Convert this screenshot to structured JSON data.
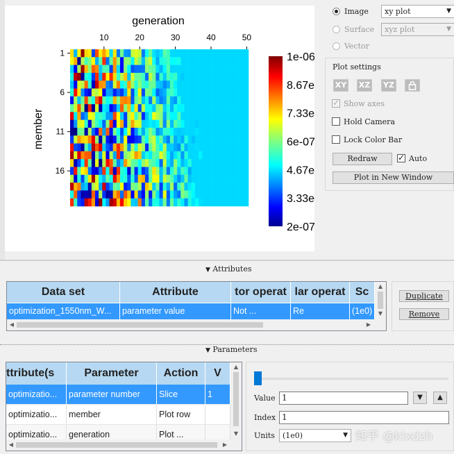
{
  "plot": {
    "x_axis_title": "generation",
    "y_axis_title": "member",
    "x_ticks": [
      "10",
      "20",
      "30",
      "40",
      "50"
    ],
    "y_ticks": [
      "1",
      "6",
      "11",
      "16"
    ],
    "colorbar_labels": [
      "1e-06",
      "8.67e",
      "7.33e",
      "6e-07",
      "4.67e",
      "3.33e",
      "2e-07"
    ]
  },
  "chart_data": {
    "type": "heatmap",
    "xlabel": "generation",
    "ylabel": "member",
    "x_range": [
      1,
      50
    ],
    "y_range": [
      1,
      20
    ],
    "colorbar_range": [
      2e-07,
      1e-06
    ],
    "colorbar_labels": [
      "1e-06",
      "8.67e",
      "7.33e",
      "6e-07",
      "4.67e",
      "3.33e",
      "2e-07"
    ],
    "colormap": "jet",
    "baseline_value": 4.7e-07,
    "rows": 20,
    "cols": 50
  },
  "plot_type": {
    "image_label": "Image",
    "image_select": "xy plot",
    "surface_label": "Surface",
    "surface_select": "xyz plot",
    "vector_label": "Vector"
  },
  "plot_settings": {
    "title": "Plot settings",
    "axis_buttons": [
      "XY",
      "XZ",
      "YZ"
    ],
    "show_axes": "Show axes",
    "hold_camera": "Hold Camera",
    "lock_color_bar": "Lock Color Bar",
    "redraw": "Redraw",
    "auto": "Auto",
    "plot_new_window": "Plot in New Window"
  },
  "attributes": {
    "header": "Attributes",
    "columns": [
      "Data set",
      "Attribute",
      "tor operat",
      "lar operat",
      "Sc"
    ],
    "row": [
      "optimization_1550nm_W...",
      "parameter value",
      "Not ...",
      "Re",
      "(1e0)"
    ],
    "duplicate": "Duplicate",
    "remove": "Remove"
  },
  "parameters": {
    "header": "Parameters",
    "columns": [
      "ttribute(s",
      "Parameter",
      "Action",
      "V"
    ],
    "rows": [
      [
        "optimizatio...",
        "parameter number",
        "Slice",
        "1"
      ],
      [
        "optimizatio...",
        "member",
        "Plot row",
        ""
      ],
      [
        "optimizatio...",
        "generation",
        "Plot ...",
        ""
      ]
    ],
    "value_label": "Value",
    "value": "1",
    "index_label": "Index",
    "index": "1",
    "units_label": "Units",
    "units": "(1e0)",
    "slider_fraction": 0
  },
  "watermark": "知乎 @klxdzh",
  "colors": {
    "selection": "#3399ff",
    "header_bg": "#b6d8f2"
  }
}
